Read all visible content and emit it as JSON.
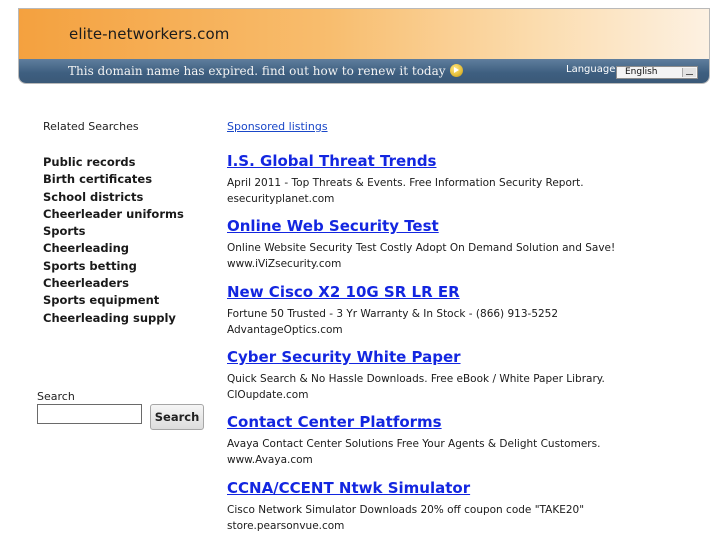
{
  "header": {
    "site_title": "elite-networkers.com",
    "expired_message": "This domain name has expired. find out how to renew it today",
    "renew_icon": "play-circle-icon",
    "language_label": "Language:",
    "language_selected": "English"
  },
  "sidebar": {
    "related_title": "Related Searches",
    "items": [
      {
        "label": "Public records"
      },
      {
        "label": "Birth certificates"
      },
      {
        "label": "School districts"
      },
      {
        "label": "Cheerleader uniforms"
      },
      {
        "label": "Sports"
      },
      {
        "label": "Cheerleading"
      },
      {
        "label": "Sports betting"
      },
      {
        "label": "Cheerleaders"
      },
      {
        "label": "Sports equipment"
      },
      {
        "label": "Cheerleading supply"
      }
    ],
    "search_label": "Search",
    "search_value": "",
    "search_button": "Search"
  },
  "main": {
    "sponsored_label": "Sponsored listings",
    "listings": [
      {
        "title": "I.S. Global Threat Trends",
        "desc": "April 2011 - Top Threats & Events. Free Information Security Report.",
        "url": "esecurityplanet.com"
      },
      {
        "title": "Online Web Security Test",
        "desc": "Online Website Security Test Costly Adopt On Demand Solution and Save!",
        "url": "www.iViZsecurity.com"
      },
      {
        "title": "New Cisco X2 10G SR LR ER",
        "desc": "Fortune 50 Trusted - 3 Yr Warranty & In Stock - (866) 913-5252",
        "url": "AdvantageOptics.com"
      },
      {
        "title": "Cyber Security White Paper",
        "desc": "Quick Search & No Hassle Downloads. Free eBook / White Paper Library.",
        "url": "CIOupdate.com"
      },
      {
        "title": "Contact Center Platforms",
        "desc": "Avaya Contact Center Solutions Free Your Agents & Delight Customers.",
        "url": "www.Avaya.com"
      },
      {
        "title": "CCNA/CCENT Ntwk Simulator",
        "desc": "Cisco Network Simulator Downloads 20% off coupon code \"TAKE20\"",
        "url": "store.pearsonvue.com"
      }
    ]
  }
}
